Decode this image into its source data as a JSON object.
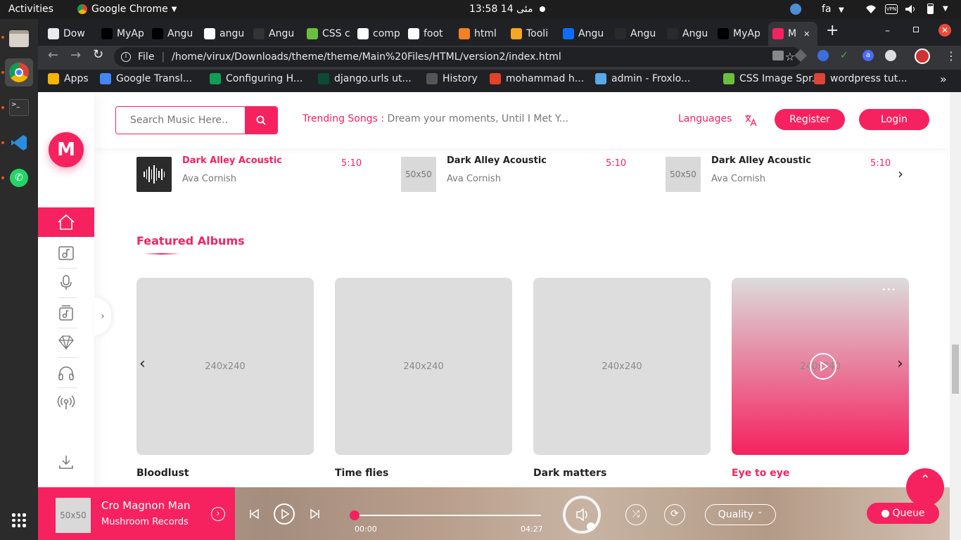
{
  "os": {
    "activities": "Activities",
    "app_menu": "Google Chrome",
    "clock": "13:58  14 مئی",
    "lang": "fa"
  },
  "browser": {
    "tabs": [
      {
        "label": "Dow",
        "icon": "download-icon"
      },
      {
        "label": "MyAp",
        "icon": "A"
      },
      {
        "label": "Angu",
        "icon": "A"
      },
      {
        "label": "angu",
        "icon": "G"
      },
      {
        "label": "Angu",
        "icon": ""
      },
      {
        "label": "CSS c",
        "icon": "css"
      },
      {
        "label": "comp",
        "icon": "G"
      },
      {
        "label": "foot",
        "icon": "G"
      },
      {
        "label": "html",
        "icon": "so"
      },
      {
        "label": "Tooli",
        "icon": "shield"
      },
      {
        "label": "Angu",
        "icon": "MDB"
      },
      {
        "label": "Angu",
        "icon": "ng"
      },
      {
        "label": "Angu",
        "icon": "ng"
      },
      {
        "label": "MyAp",
        "icon": "A"
      },
      {
        "label": "M",
        "icon": "M"
      }
    ],
    "address": {
      "scheme_label": "File",
      "url": "/home/virux/Downloads/theme/theme/Main%20Files/HTML/version2/index.html"
    },
    "bookmarks": [
      {
        "label": "Apps"
      },
      {
        "label": "Google Transl..."
      },
      {
        "label": "Configuring H..."
      },
      {
        "label": "django.urls ut..."
      },
      {
        "label": "History"
      },
      {
        "label": "mohammad h..."
      },
      {
        "label": "admin - Froxlo..."
      },
      {
        "label": "CSS Image Spr..."
      },
      {
        "label": "wordpress tut..."
      }
    ],
    "more_bookmarks": "»"
  },
  "site": {
    "logo_letter": "M",
    "search_placeholder": "Search Music Here..",
    "trending_label": "Trending Songs :",
    "trending_text": "Dream your moments, Until I Met Y...",
    "languages_label": "Languages",
    "register_label": "Register",
    "login_label": "Login",
    "recent": [
      {
        "title": "Dark Alley Acoustic",
        "artist": "Ava Cornish",
        "duration": "5:10",
        "thumb": "",
        "active": true
      },
      {
        "title": "Dark Alley Acoustic",
        "artist": "Ava Cornish",
        "duration": "5:10",
        "thumb": "50x50",
        "active": false
      },
      {
        "title": "Dark Alley Acoustic",
        "artist": "Ava Cornish",
        "duration": "5:10",
        "thumb": "50x50",
        "active": false
      }
    ],
    "featured_title": "Featured Albums",
    "albums": [
      {
        "placeholder": "240x240",
        "title": "Bloodlust",
        "active": false
      },
      {
        "placeholder": "240x240",
        "title": "Time flies",
        "active": false
      },
      {
        "placeholder": "240x240",
        "title": "Dark matters",
        "active": false
      },
      {
        "placeholder": "240x240",
        "title": "Eye to eye",
        "active": true
      }
    ],
    "album_menu": "•••"
  },
  "player": {
    "thumb": "50x50",
    "track": "Cro Magnon Man",
    "label": "Mushroom Records",
    "time_current": "00:00",
    "time_total": "04:27",
    "progress": 0.0,
    "quality_label": "Quality",
    "queue_label": "Queue"
  },
  "colors": {
    "accent": "#f5225f",
    "chrome_bg": "#202124",
    "topbar_bg": "#1d1d1d"
  }
}
